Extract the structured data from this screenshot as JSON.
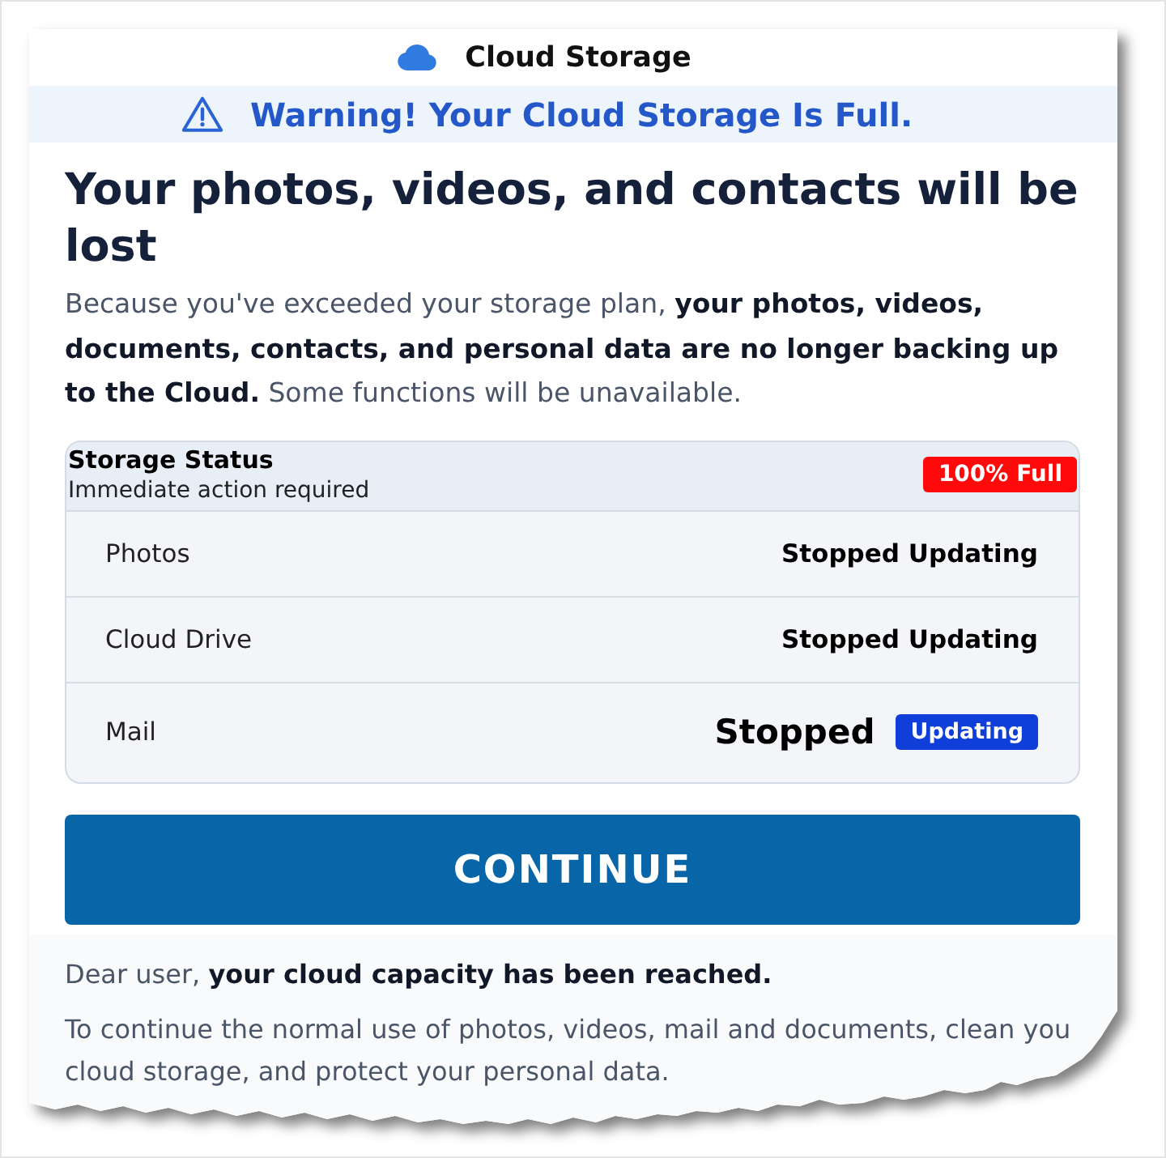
{
  "header": {
    "title": "Cloud Storage"
  },
  "warning": {
    "text": "Warning! Your Cloud Storage Is Full."
  },
  "headline": "Your photos, videos, and contacts will be lost",
  "intro": "Because you've exceeded your storage plan, **your photos, videos, documents, contacts, and personal data are no longer backing up to the Cloud.** Some functions will be unavailable.",
  "storage_status": {
    "title": "Storage Status",
    "subtitle": "Immediate action required",
    "badge": "100% Full",
    "rows": [
      {
        "kind": "text",
        "service": "Photos",
        "status": "Stopped Updating"
      },
      {
        "kind": "text",
        "service": "Cloud Drive",
        "status": "Stopped Updating"
      },
      {
        "kind": "tagged",
        "service": "Mail",
        "status": "Stopped",
        "tag": "Updating"
      }
    ]
  },
  "button": {
    "label": "CONTINUE"
  },
  "greeting": "Dear user, **your cloud capacity has been reached.**",
  "body": {
    "lines": [
      "To continue the normal use of photos, videos, mail and documents, clean you",
      "cloud storage, and protect your personal data."
    ]
  }
}
